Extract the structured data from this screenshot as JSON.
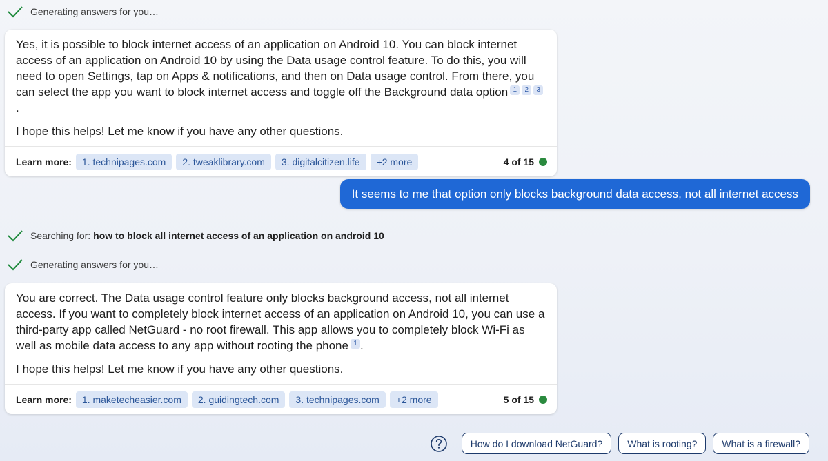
{
  "turn1": {
    "status": "Generating answers for you…",
    "answer_p1": "Yes, it is possible to block internet access of an application on Android 10. You can block internet access of an application on Android 10 by using the Data usage control feature. To do this, you will need to open Settings, tap on Apps & notifications, and then on Data usage control. From there, you can select the app you want to block internet access and toggle off the Background data option",
    "citations": [
      "1",
      "2",
      "3"
    ],
    "answer_p1_end": ".",
    "answer_p2": "I hope this helps! Let me know if you have any other questions.",
    "learn_more_label": "Learn more:",
    "sources": [
      "1. technipages.com",
      "2. tweaklibrary.com",
      "3. digitalcitizen.life",
      "+2 more"
    ],
    "turn_count": "4 of 15"
  },
  "user_message": "It seems to me that option only blocks background data access, not all internet access",
  "turn2": {
    "search_prefix": "Searching for:",
    "search_query": "how to block all internet access of an application on android 10",
    "status": "Generating answers for you…",
    "answer_p1": "You are correct. The Data usage control feature only blocks background access, not all internet access. If you want to completely block internet access of an application on Android 10, you can use a third-party app called NetGuard - no root firewall. This app allows you to completely block Wi-Fi as well as mobile data access to any app without rooting the phone",
    "citations": [
      "1"
    ],
    "answer_p1_end": ".",
    "answer_p2": "I hope this helps! Let me know if you have any other questions.",
    "learn_more_label": "Learn more:",
    "sources": [
      "1. maketecheasier.com",
      "2. guidingtech.com",
      "3. technipages.com",
      "+2 more"
    ],
    "turn_count": "5 of 15"
  },
  "suggestions": [
    "How do I download NetGuard?",
    "What is rooting?",
    "What is a firewall?"
  ],
  "icons": {
    "check": "check-icon",
    "help": "question-circle-icon",
    "turn_indicator": "status-dot"
  },
  "colors": {
    "accent": "#1f68d6",
    "check": "#1e8a3c",
    "chip_bg": "#dce6f6",
    "chip_text": "#2a5598",
    "status_dot": "#2a8a3e",
    "suggestion_border": "#1d3a6b"
  }
}
